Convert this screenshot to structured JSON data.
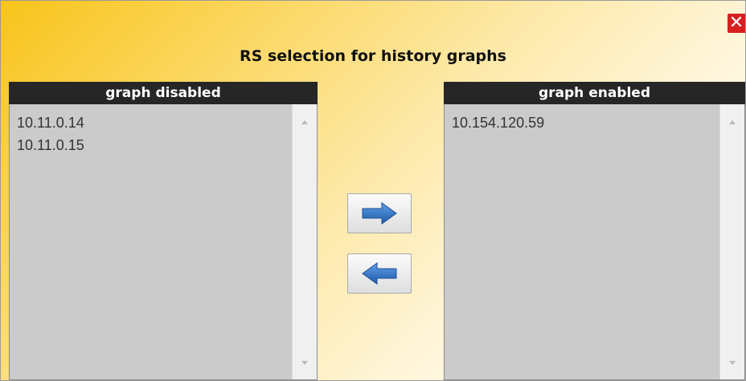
{
  "dialog": {
    "title": "RS selection for history graphs",
    "close_label": "✕"
  },
  "left_panel": {
    "header": "graph disabled",
    "items": [
      "10.11.0.14",
      "10.11.0.15"
    ]
  },
  "right_panel": {
    "header": "graph enabled",
    "items": [
      "10.154.120.59"
    ]
  },
  "buttons": {
    "move_right_icon": "arrow-right-icon",
    "move_left_icon": "arrow-left-icon"
  },
  "colors": {
    "gradient_start": "#f8c41a",
    "gradient_end": "#fffaf0",
    "header_bg": "#262626",
    "list_bg": "#cbcbcb",
    "arrow_blue": "#2f6fc0",
    "close_red": "#d62020"
  }
}
